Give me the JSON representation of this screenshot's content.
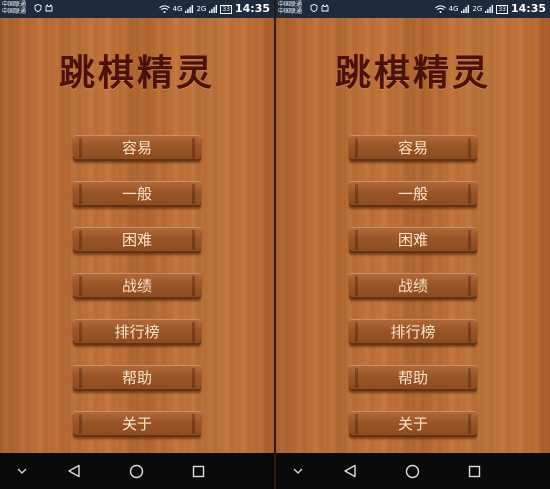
{
  "screens": [
    {
      "status": {
        "carrier_line1": "中国联通",
        "carrier_line2": "中国联通",
        "signal1": "4G",
        "signal2": "2G",
        "battery": "33",
        "time": "14:35"
      },
      "title": "跳棋精灵",
      "buttons": [
        "容易",
        "一般",
        "困难",
        "战绩",
        "排行榜",
        "帮助",
        "关于"
      ]
    },
    {
      "status": {
        "carrier_line1": "中国联通",
        "carrier_line2": "中国联通",
        "signal1": "4G",
        "signal2": "2G",
        "battery": "33",
        "time": "14:35"
      },
      "title": "跳棋精灵",
      "buttons": [
        "容易",
        "一般",
        "困难",
        "战绩",
        "排行榜",
        "帮助",
        "关于"
      ]
    }
  ],
  "colors": {
    "title": "#4a1208",
    "button_text": "#fbe6cf",
    "status_bar": "#1d2c3d",
    "nav_bar": "#0a0a0a",
    "wood": "#c8783c"
  },
  "icons": {
    "status": [
      "shield-icon",
      "cat-icon",
      "wifi-icon",
      "signal-icon",
      "battery-icon"
    ],
    "nav": [
      "chevron-down-icon",
      "back-icon",
      "home-icon",
      "recent-apps-icon"
    ]
  }
}
